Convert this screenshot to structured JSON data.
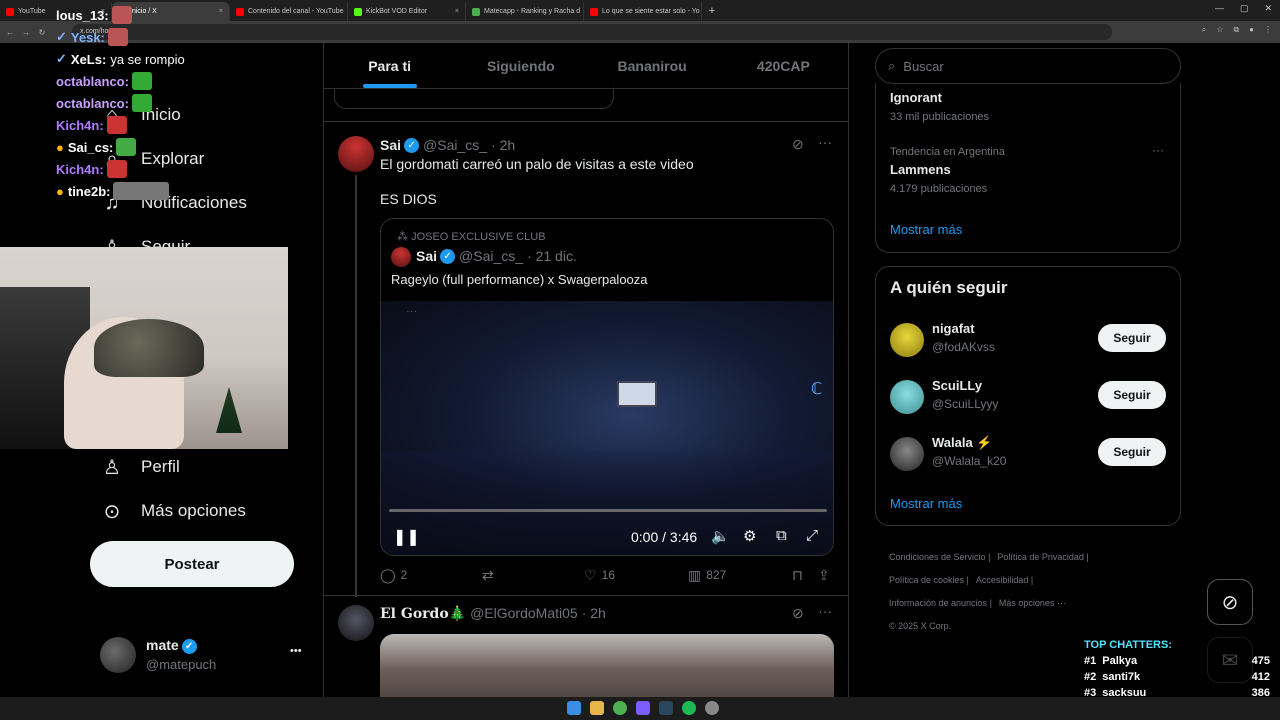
{
  "browser": {
    "tabs": [
      {
        "label": "YouTube",
        "color": "#ff0000"
      },
      {
        "label": "Inicio / X",
        "color": "#ffffff",
        "active": true
      },
      {
        "label": "Contenido del canal - YouTube",
        "color": "#ff0000"
      },
      {
        "label": "KickBot VOD Editor",
        "color": "#53fc18"
      },
      {
        "label": "Matecapp - Ranking y Racha d",
        "color": "#4caf50"
      },
      {
        "label": "Lo que se siente estar solo - Yo",
        "color": "#ff0000"
      }
    ],
    "url": "x.com/home",
    "new_tab": "+"
  },
  "chat": {
    "lines": [
      {
        "user": "lous_13:",
        "color": "#ffffff",
        "msg": "",
        "emote": "#b55"
      },
      {
        "user": "Yesk:",
        "color": "#7fb2ff",
        "msg": "",
        "emote": "#b55"
      },
      {
        "user": "XeLs:",
        "color": "#ffffff",
        "msg": "ya se rompio",
        "emote": ""
      },
      {
        "user": "octablanco:",
        "color": "#c6a0ff",
        "msg": "",
        "emote": "#3a3"
      },
      {
        "user": "octablanco:",
        "color": "#c6a0ff",
        "msg": "",
        "emote": "#3a3"
      },
      {
        "user": "Kich4n:",
        "color": "#b07cff",
        "msg": "",
        "emote": "#c33"
      },
      {
        "user": "Sai_cs:",
        "color": "#ffffff",
        "msg": "",
        "emote": "#4a4"
      },
      {
        "user": "Kich4n:",
        "color": "#b07cff",
        "msg": "",
        "emote": "#c33"
      },
      {
        "user": "tine2b:",
        "color": "#ffffff",
        "msg": "",
        "emote": "#777"
      }
    ]
  },
  "sidebar": {
    "items": [
      {
        "label": "Inicio",
        "icon": "home-icon",
        "glyph": "⌂"
      },
      {
        "label": "Explorar",
        "icon": "search-icon",
        "glyph": "⌕"
      },
      {
        "label": "Notificaciones",
        "icon": "bell-icon",
        "glyph": "🔔"
      },
      {
        "label": "Seguir",
        "icon": "follow-icon",
        "glyph": "👤"
      },
      {
        "label": "Perfil",
        "icon": "profile-icon",
        "glyph": "👤"
      },
      {
        "label": "Más opciones",
        "icon": "more-options-icon",
        "glyph": "⋯"
      }
    ],
    "post_label": "Postear",
    "account": {
      "name": "mate",
      "handle": "@matepuch",
      "menu": "•••"
    }
  },
  "feed": {
    "tabs": [
      "Para ti",
      "Siguiendo",
      "Bananirou",
      "420CAP"
    ],
    "tweet1": {
      "name": "Sai",
      "handle": "@Sai_cs_",
      "time": "· 2h",
      "text1": "El gordomati carreó un palo de visitas a este video",
      "text2": "ES DIOS",
      "quote": {
        "community": "JOSEO EXCLUSIVE CLUB",
        "name": "Sai",
        "handle": "@Sai_cs_",
        "time": "· 21 dic.",
        "text": "Rageylo (full performance) x Swagerpalooza",
        "video_time": "0:00 / 3:46",
        "progress": 0.0
      },
      "stats": {
        "replies": "2",
        "retweets": "",
        "likes": "16",
        "views": "827"
      }
    },
    "tweet2": {
      "name": "El Gordo🎄",
      "handle": "@ElGordoMati05",
      "time": "· 2h"
    }
  },
  "right": {
    "search_placeholder": "Buscar",
    "trends": [
      {
        "context": "",
        "name": "Ignorant",
        "count": "33 mil publicaciones"
      },
      {
        "context": "Tendencia en Argentina",
        "name": "Lammens",
        "count": "4.179 publicaciones"
      }
    ],
    "trends_more": "Mostrar más",
    "follow_title": "A quién seguir",
    "follow": [
      {
        "name": "nigafat",
        "handle": "@fodAKvss",
        "button": "Seguir",
        "color": "#d6c21a"
      },
      {
        "name": "ScuiLLy",
        "handle": "@ScuiLLyyy",
        "button": "Seguir",
        "color": "#6cc4c8"
      },
      {
        "name": "Walala ⚡",
        "handle": "@Walala_k20",
        "button": "Seguir",
        "color": "#555555"
      }
    ],
    "follow_more": "Mostrar más",
    "footer": [
      "Condiciones de Servicio",
      "Política de Privacidad",
      "Política de cookies",
      "Accesibilidad",
      "Información de anuncios",
      "Más opciones ···",
      "© 2025 X Corp."
    ]
  },
  "top_chatters": {
    "title": "TOP CHATTERS:",
    "rows": [
      {
        "rank": "#1",
        "name": "Palkya",
        "count": "475"
      },
      {
        "rank": "#2",
        "name": "santi7k",
        "count": "412"
      },
      {
        "rank": "#3",
        "name": "sacksuu",
        "count": "386"
      }
    ]
  },
  "colors": {
    "accent": "#1d9bf0",
    "background": "#000000",
    "border": "#2f3336"
  }
}
